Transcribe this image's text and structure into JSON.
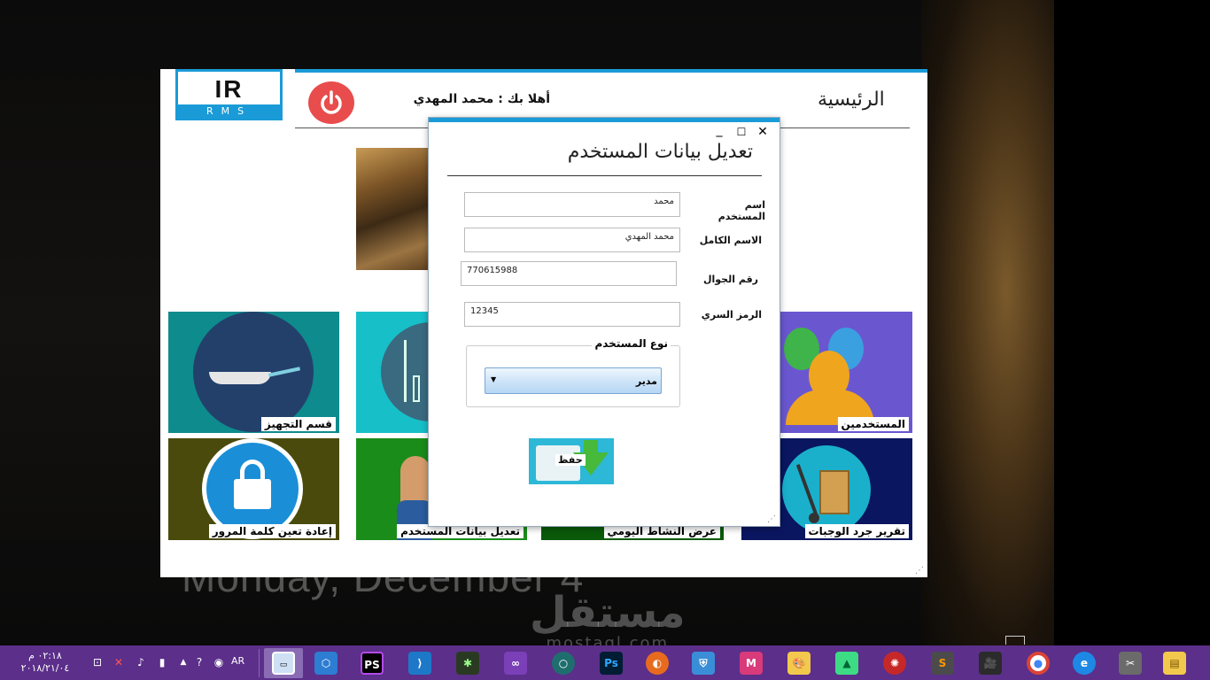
{
  "desktop": {
    "date_text": "Monday, December 4",
    "watermark": "مستقل",
    "watermark_sub": "mostaql.com"
  },
  "main_window": {
    "logo_mark": "IR",
    "logo_text": "RMS",
    "welcome": "أهلا بك : محمد المهدي",
    "title": "الرئيسية",
    "tiles": {
      "kitchen": "قسم التجهيز",
      "users": "المستخدمين",
      "reset_password": "إعادة تعين كلمة المرور",
      "edit_user": "تعديل بيانات المستخدم",
      "daily_activity": "عرض النشاط اليومي",
      "meals_inventory": "تقرير جرد الوجبات"
    }
  },
  "dialog": {
    "title": "تعديل بيانات المستخدم",
    "controls": {
      "minimize": "_",
      "maximize": "☐",
      "close": "✕"
    },
    "fields": {
      "username": {
        "label": "اسم المستخدم",
        "value": "محمد"
      },
      "fullname": {
        "label": "الاسم الكامل",
        "value": "محمد المهدي"
      },
      "mobile": {
        "label": "رقم الجوال",
        "value": "770615988"
      },
      "password": {
        "label": "الرمز السري",
        "value": "12345"
      }
    },
    "user_type": {
      "legend": "نوع المستخدم",
      "selected": "مدير"
    },
    "save_label": "حفظ"
  },
  "taskbar": {
    "time": "٠٢:١٨ م",
    "date": "٢٠١٨/٢١/٠٤",
    "language": "AR",
    "apps": [
      "file-explorer-window",
      "virtualbox",
      "phpstorm",
      "vscode",
      "cockos",
      "visual-studio",
      "android-studio-o",
      "photoshop",
      "firefox",
      "security-shield",
      "app-m",
      "paint",
      "android-studio",
      "antivirus",
      "sublime-text",
      "video-camera",
      "chrome",
      "internet-explorer",
      "tools",
      "file-manager",
      "windows-start"
    ]
  },
  "colors": {
    "accent": "#1a9bd7",
    "taskbar": "#5b2f8a",
    "power": "#e84c4c"
  }
}
